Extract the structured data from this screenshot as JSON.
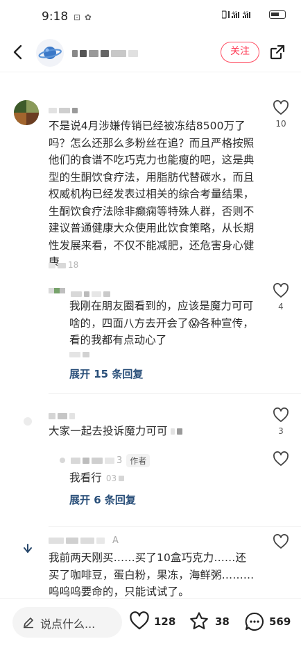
{
  "status_bar": {
    "time": "9:18",
    "indicators": "⊡ ✿",
    "network": "4G",
    "signal_icons": "signal-icon, wifi-icon, battery-icon"
  },
  "nav": {
    "follow_label": "关注",
    "back_icon": "back-arrow-icon",
    "share_icon": "share-icon"
  },
  "comments": [
    {
      "text": "不是说4月涉嫌传销已经被冻结8500万了吗？怎么还那么多粉丝在追？而且严格按照他们的食谱不吃巧克力也能瘦的吧，这是典型的生酮饮食疗法，用脂肪代替碳水，而且权威机构已经发表过相关的综合考量结果，生酮饮食疗法除非癫痫等特殊人群，否则不建议普通健康大众使用此饮食策略，从长期性发展来看，不仅不能减肥，还危害身心健康",
      "meta_suffix": "18",
      "likes": "10",
      "reply": {
        "text": "我刚在朋友圈看到的，应该是魔力可可啥的，四面八方去开会了😱各种宣传，看的我都有点动心了",
        "likes": "4"
      },
      "expand_label": "展开 15 条回复"
    },
    {
      "text": "大家一起去投诉魔力可可",
      "likes": "3",
      "reply": {
        "name_suffix": "3",
        "author_tag": "作者",
        "text": "我看行",
        "meta_prefix": "03"
      },
      "expand_label": "展开 6 条回复"
    },
    {
      "name_suffix": "A",
      "text": "我前两天刚买……买了10盒巧克力……还买了咖啡豆，蛋白粉，果冻，海鲜粥………呜呜呜要命的，只能试试了。"
    }
  ],
  "bottom_bar": {
    "input_placeholder": "说点什么...",
    "likes": "128",
    "favorites": "38",
    "comments": "569"
  },
  "colors": {
    "accent": "#ff3b55",
    "link": "#274d78",
    "text": "#2b2b2b",
    "muted": "#b5b5b5"
  }
}
